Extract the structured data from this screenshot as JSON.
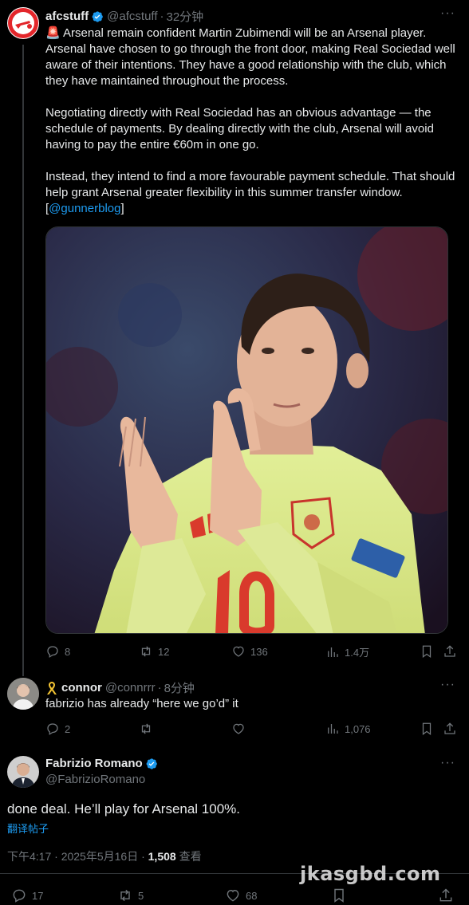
{
  "tweet1": {
    "display_name": "afcstuff",
    "handle": "@afcstuff",
    "time": "32分钟",
    "text": "🚨 Arsenal remain confident Martin Zubimendi will be an Arsenal player. Arsenal have chosen to go through the front door, making Real Sociedad well aware of their intentions. They have a good relationship with the club, which they have maintained throughout the process.\n\nNegotiating directly with Real Sociedad has an obvious advantage — the schedule of payments. By dealing directly with the club, Arsenal will avoid having to pay the entire €60m in one go.\n\nInstead, they intend to find a more favourable payment schedule. That should help grant Arsenal greater flexibility in this summer transfer window. [",
    "mention": "@gunnerblog",
    "text_end": "]",
    "replies": "8",
    "retweets": "12",
    "likes": "136",
    "views": "1.4万"
  },
  "tweet2": {
    "display_name": "connor",
    "handle": "@connrrr",
    "time": "8分钟",
    "text": "fabrizio has already “here we go’d” it",
    "replies": "2",
    "views": "1,076"
  },
  "tweet3": {
    "display_name": "Fabrizio Romano",
    "handle": "@FabrizioRomano",
    "text": "done deal. He’ll play for Arsenal 100%.",
    "translate": "翻译帖子",
    "timestamp": "下午4:17 · 2025年5月16日 · ",
    "views_count": "1,508",
    "views_label": " 查看",
    "replies": "17",
    "retweets": "5",
    "likes": "68"
  },
  "watermark": "jkasgbd.com",
  "colors": {
    "background": "#000000",
    "text": "#e7e9ea",
    "muted": "#71767b",
    "link": "#1d9bf0",
    "verified": "#1d9bf0",
    "kit_yellow": "#d9e88a"
  }
}
